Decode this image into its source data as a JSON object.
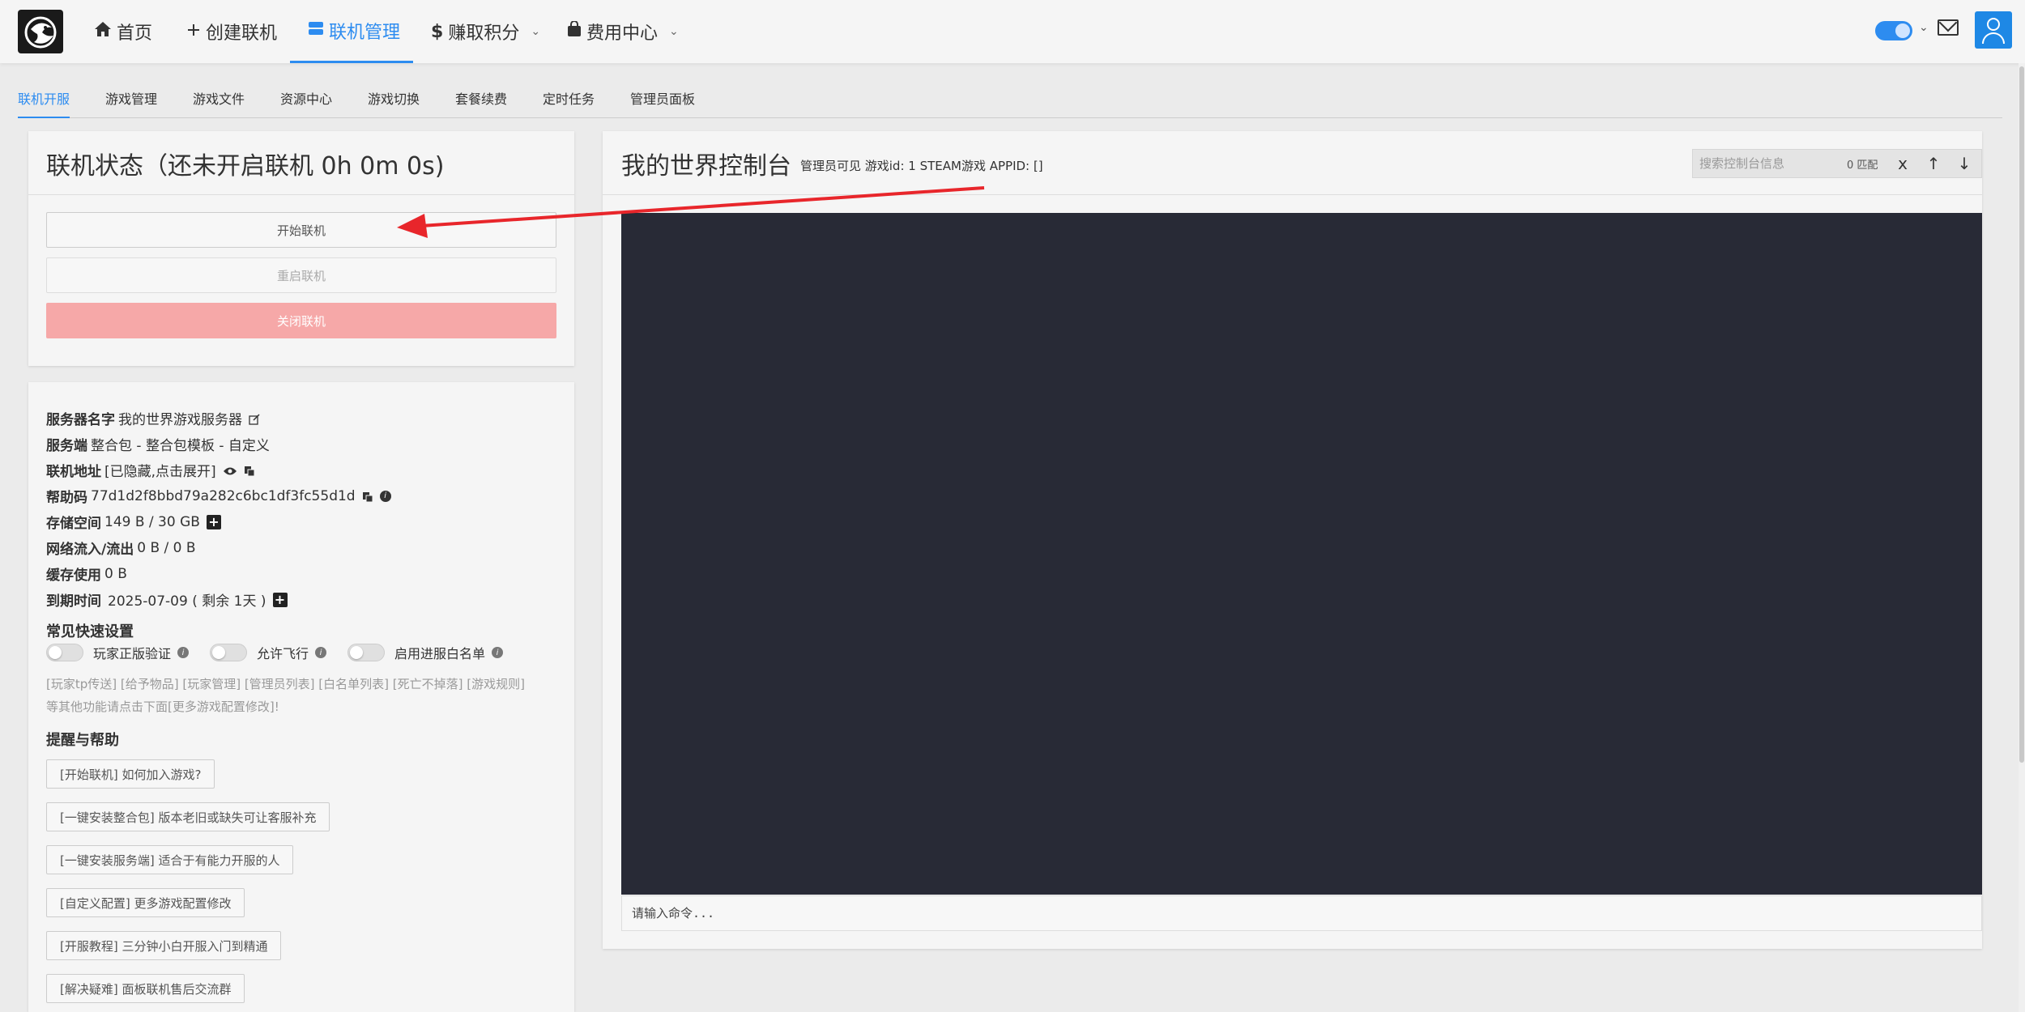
{
  "nav": {
    "items": [
      {
        "label": "首页",
        "icon": "home-icon"
      },
      {
        "label": "创建联机",
        "icon": "plus-icon"
      },
      {
        "label": "联机管理",
        "icon": "server-icon"
      },
      {
        "label": "赚取积分",
        "icon": "dollar-icon"
      },
      {
        "label": "费用中心",
        "icon": "bag-icon"
      }
    ],
    "active_color": "#2d8cf0"
  },
  "subtabs": [
    "联机开服",
    "游戏管理",
    "游戏文件",
    "资源中心",
    "游戏切换",
    "套餐续费",
    "定时任务",
    "管理员面板"
  ],
  "status": {
    "title": "联机状态（还未开启联机 0h 0m 0s)",
    "start_label": "开始联机",
    "restart_label": "重启联机",
    "stop_label": "关闭联机"
  },
  "info": {
    "server_name_label": "服务器名字",
    "server_name": "我的世界游戏服务器",
    "server_side_label": "服务端",
    "server_side": "整合包 - 整合包模板 - 自定义",
    "address_label": "联机地址",
    "address": "[已隐藏,点击展开]",
    "help_code_label": "帮助码",
    "help_code": "77d1d2f8bbd79a282c6bc1df3fc55d1d",
    "storage_label": "存储空间",
    "storage": "149 B / 30 GB",
    "network_label": "网络流入/流出",
    "network": "0 B / 0 B",
    "cache_label": "缓存使用",
    "cache": "0 B",
    "expire_label": "到期时间",
    "expire": "2025-07-09 ( 剩余 1天 )"
  },
  "quick": {
    "title": "常见快速设置",
    "toggles": [
      "玩家正版验证",
      "允许飞行",
      "启用进服白名单"
    ],
    "links": "[玩家tp传送] [给予物品] [玩家管理] [管理员列表] [白名单列表] [死亡不掉落] [游戏规则]",
    "more": "等其他功能请点击下面[更多游戏配置修改]!"
  },
  "help": {
    "title": "提醒与帮助",
    "buttons": [
      "[开始联机] 如何加入游戏?",
      "[一键安装整合包] 版本老旧或缺失可让客服补充",
      "[一键安装服务端] 适合于有能力开服的人",
      "[自定义配置] 更多游戏配置修改",
      "[开服教程] 三分钟小白开服入门到精通",
      "[解决疑难] 面板联机售后交流群"
    ]
  },
  "console": {
    "title": "我的世界控制台",
    "subtitle": "管理员可见 游戏id: 1 STEAM游戏 APPID: []",
    "search_placeholder": "搜索控制台信息",
    "match_count": "0 匹配",
    "close_label": "x",
    "up_label": "↑",
    "down_label": "↓",
    "cmd_placeholder": "请输入命令..."
  },
  "colors": {
    "accent": "#2d8cf0",
    "danger_button": "#f6a8a8",
    "terminal_bg": "#282a36",
    "annotation_arrow": "#e8262b"
  }
}
